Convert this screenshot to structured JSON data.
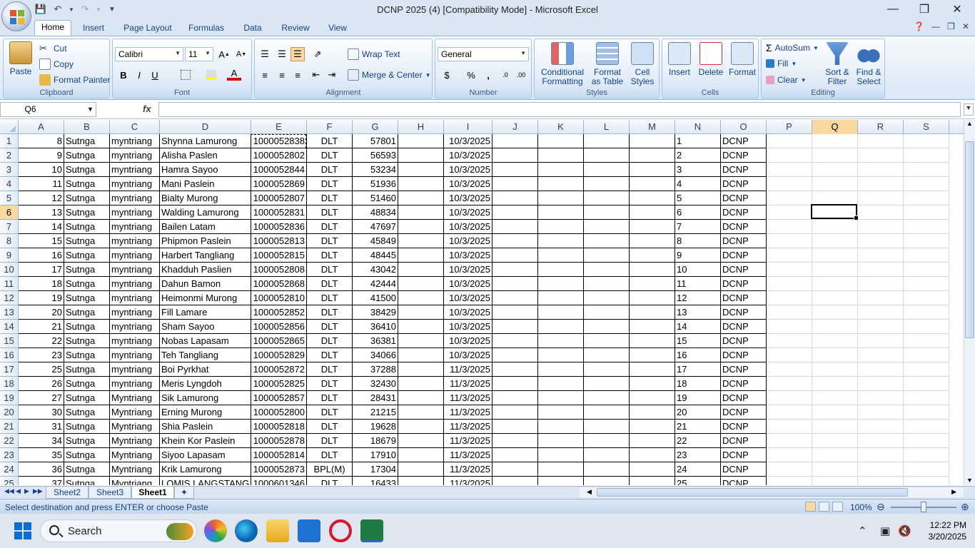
{
  "window": {
    "title": "DCNP 2025 (4)  [Compatibility Mode] - Microsoft Excel"
  },
  "ribbon_tabs": [
    "Home",
    "Insert",
    "Page Layout",
    "Formulas",
    "Data",
    "Review",
    "View"
  ],
  "clipboard": {
    "paste": "Paste",
    "cut": "Cut",
    "copy": "Copy",
    "format_painter": "Format Painter",
    "label": "Clipboard"
  },
  "font": {
    "name": "Calibri",
    "size": "11",
    "label": "Font",
    "bold": "B",
    "italic": "I",
    "underline": "U"
  },
  "alignment": {
    "wrap_text": "Wrap Text",
    "merge_center": "Merge & Center",
    "label": "Alignment"
  },
  "number": {
    "format": "General",
    "currency": "$",
    "percent": "%",
    "comma": ",",
    "label": "Number"
  },
  "styles": {
    "conditional": "Conditional",
    "conditional2": "Formatting",
    "as_table": "Format",
    "as_table2": "as Table",
    "cell": "Cell",
    "cell2": "Styles",
    "label": "Styles"
  },
  "cells": {
    "insert": "Insert",
    "delete": "Delete",
    "format": "Format",
    "label": "Cells"
  },
  "editing": {
    "autosum": "AutoSum",
    "fill": "Fill",
    "clear": "Clear",
    "sort": "Sort &",
    "sort2": "Filter",
    "find": "Find &",
    "find2": "Select",
    "label": "Editing"
  },
  "formula_bar": {
    "name_box": "Q6",
    "fx": "fx",
    "value": ""
  },
  "columns": [
    "A",
    "B",
    "C",
    "D",
    "E",
    "F",
    "G",
    "H",
    "I",
    "J",
    "K",
    "L",
    "M",
    "N",
    "O",
    "P",
    "Q",
    "R",
    "S"
  ],
  "selected_column": "Q",
  "selected_row": 6,
  "rows": [
    {
      "n": "1",
      "a": "8",
      "b": "Sutnga",
      "c": "myntriang",
      "d": "Shynna Lamurong",
      "e": "1000052838",
      "f": "DLT",
      "g": "57801",
      "i": "10/3/2025",
      "o": "DCNP"
    },
    {
      "n": "2",
      "a": "9",
      "b": "Sutnga",
      "c": "myntriang",
      "d": "Alisha Paslen",
      "e": "1000052802",
      "f": "DLT",
      "g": "56593",
      "i": "10/3/2025",
      "o": "DCNP"
    },
    {
      "n": "3",
      "a": "10",
      "b": "Sutnga",
      "c": "myntriang",
      "d": "Hamra Sayoo",
      "e": "1000052844",
      "f": "DLT",
      "g": "53234",
      "i": "10/3/2025",
      "o": "DCNP"
    },
    {
      "n": "4",
      "a": "11",
      "b": "Sutnga",
      "c": "myntriang",
      "d": "Mani Paslein",
      "e": "1000052869",
      "f": "DLT",
      "g": "51936",
      "i": "10/3/2025",
      "o": "DCNP"
    },
    {
      "n": "5",
      "a": "12",
      "b": "Sutnga",
      "c": "myntriang",
      "d": "Bialty Murong",
      "e": "1000052807",
      "f": "DLT",
      "g": "51460",
      "i": "10/3/2025",
      "o": "DCNP"
    },
    {
      "n": "6",
      "a": "13",
      "b": "Sutnga",
      "c": "myntriang",
      "d": "Walding Lamurong",
      "e": "1000052831",
      "f": "DLT",
      "g": "48834",
      "i": "10/3/2025",
      "o": "DCNP"
    },
    {
      "n": "7",
      "a": "14",
      "b": "Sutnga",
      "c": "myntriang",
      "d": "Bailen Latam",
      "e": "1000052836",
      "f": "DLT",
      "g": "47697",
      "i": "10/3/2025",
      "o": "DCNP"
    },
    {
      "n": "8",
      "a": "15",
      "b": "Sutnga",
      "c": "myntriang",
      "d": "Phipmon Paslein",
      "e": "1000052813",
      "f": "DLT",
      "g": "45849",
      "i": "10/3/2025",
      "o": "DCNP"
    },
    {
      "n": "9",
      "a": "16",
      "b": "Sutnga",
      "c": "myntriang",
      "d": "Harbert Tangliang",
      "e": "1000052815",
      "f": "DLT",
      "g": "48445",
      "i": "10/3/2025",
      "o": "DCNP"
    },
    {
      "n": "10",
      "a": "17",
      "b": "Sutnga",
      "c": "myntriang",
      "d": "Khadduh Paslien",
      "e": "1000052808",
      "f": "DLT",
      "g": "43042",
      "i": "10/3/2025",
      "o": "DCNP"
    },
    {
      "n": "11",
      "a": "18",
      "b": "Sutnga",
      "c": "myntriang",
      "d": "Dahun Bamon",
      "e": "1000052868",
      "f": "DLT",
      "g": "42444",
      "i": "10/3/2025",
      "o": "DCNP"
    },
    {
      "n": "12",
      "a": "19",
      "b": "Sutnga",
      "c": "myntriang",
      "d": "Heimonmi Murong",
      "e": "1000052810",
      "f": "DLT",
      "g": "41500",
      "i": "10/3/2025",
      "o": "DCNP"
    },
    {
      "n": "13",
      "a": "20",
      "b": "Sutnga",
      "c": "myntriang",
      "d": "Fill Lamare",
      "e": "1000052852",
      "f": "DLT",
      "g": "38429",
      "i": "10/3/2025",
      "o": "DCNP"
    },
    {
      "n": "14",
      "a": "21",
      "b": "Sutnga",
      "c": "myntriang",
      "d": "Sham Sayoo",
      "e": "1000052856",
      "f": "DLT",
      "g": "36410",
      "i": "10/3/2025",
      "o": "DCNP"
    },
    {
      "n": "15",
      "a": "22",
      "b": "Sutnga",
      "c": "myntriang",
      "d": "Nobas Lapasam",
      "e": "1000052865",
      "f": "DLT",
      "g": "36381",
      "i": "10/3/2025",
      "o": "DCNP"
    },
    {
      "n": "16",
      "a": "23",
      "b": "Sutnga",
      "c": "myntriang",
      "d": "Teh Tangliang",
      "e": "1000052829",
      "f": "DLT",
      "g": "34066",
      "i": "10/3/2025",
      "o": "DCNP"
    },
    {
      "n": "17",
      "a": "25",
      "b": "Sutnga",
      "c": "myntriang",
      "d": "Boi Pyrkhat",
      "e": "1000052872",
      "f": "DLT",
      "g": "37288",
      "i": "11/3/2025",
      "o": "DCNP"
    },
    {
      "n": "18",
      "a": "26",
      "b": "Sutnga",
      "c": "myntriang",
      "d": "Meris Lyngdoh",
      "e": "1000052825",
      "f": "DLT",
      "g": "32430",
      "i": "11/3/2025",
      "o": "DCNP"
    },
    {
      "n": "19",
      "a": "27",
      "b": "Sutnga",
      "c": "Myntriang",
      "d": "Sik Lamurong",
      "e": "1000052857",
      "f": "DLT",
      "g": "28431",
      "i": "11/3/2025",
      "o": "DCNP"
    },
    {
      "n": "20",
      "a": "30",
      "b": "Sutnga",
      "c": "Myntriang",
      "d": "Erning Murong",
      "e": "1000052800",
      "f": "DLT",
      "g": "21215",
      "i": "11/3/2025",
      "o": "DCNP"
    },
    {
      "n": "21",
      "a": "31",
      "b": "Sutnga",
      "c": "Myntriang",
      "d": "Shia Paslein",
      "e": "1000052818",
      "f": "DLT",
      "g": "19628",
      "i": "11/3/2025",
      "o": "DCNP"
    },
    {
      "n": "22",
      "a": "34",
      "b": "Sutnga",
      "c": "Myntriang",
      "d": "Khein Kor Paslein",
      "e": "1000052878",
      "f": "DLT",
      "g": "18679",
      "i": "11/3/2025",
      "o": "DCNP"
    },
    {
      "n": "23",
      "a": "35",
      "b": "Sutnga",
      "c": "Myntriang",
      "d": "Siyoo Lapasam",
      "e": "1000052814",
      "f": "DLT",
      "g": "17910",
      "i": "11/3/2025",
      "o": "DCNP"
    },
    {
      "n": "24",
      "a": "36",
      "b": "Sutnga",
      "c": "Myntriang",
      "d": "Krik Lamurong",
      "e": "1000052873",
      "f": "BPL(M)",
      "g": "17304",
      "i": "11/3/2025",
      "o": "DCNP"
    },
    {
      "n": "25",
      "a": "37",
      "b": "Sutnga",
      "c": "Myntriang",
      "d": "LOMIS LANGSTANG",
      "e": "1000601346",
      "f": "DLT",
      "g": "16433",
      "i": "11/3/2025",
      "o": "DCNP"
    }
  ],
  "sheets": [
    "Sheet2",
    "Sheet3",
    "Sheet1"
  ],
  "active_sheet": "Sheet1",
  "status": {
    "message": "Select destination and press ENTER or choose Paste",
    "zoom": "100%"
  },
  "taskbar": {
    "search": "Search",
    "time": "12:22 PM",
    "date": "3/20/2025"
  }
}
